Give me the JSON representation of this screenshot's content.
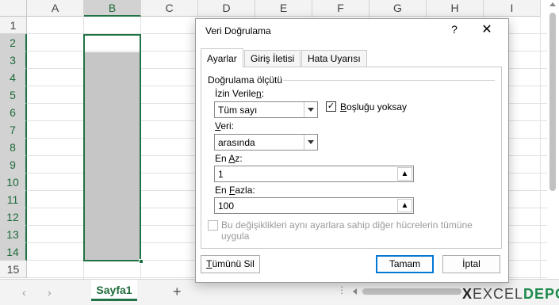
{
  "spreadsheet": {
    "columns": [
      "A",
      "B",
      "C",
      "D",
      "E",
      "F",
      "G",
      "H",
      "I"
    ],
    "rows": [
      "1",
      "2",
      "3",
      "4",
      "5",
      "6",
      "7",
      "8",
      "9",
      "10",
      "11",
      "12",
      "13",
      "14",
      "15"
    ],
    "selected_column": "B",
    "selected_range": "B2:B14"
  },
  "sheet_tabs": {
    "prev_icon": "chevron-left-icon",
    "next_icon": "chevron-right-icon",
    "active_sheet": "Sayfa1",
    "add_sheet_label": "+",
    "options_label": "⋮"
  },
  "logo": {
    "x": "X",
    "excel": "EXCEL",
    "depo": "DEPO"
  },
  "dialog": {
    "title": "Veri Doğrulama",
    "help_label": "?",
    "close_label": "✕",
    "tabs": [
      {
        "label": "Ayarlar",
        "active": true
      },
      {
        "label": "Giriş İletisi",
        "active": false
      },
      {
        "label": "Hata Uyarısı",
        "active": false
      }
    ],
    "group_label": "Doğrulama ölçütü",
    "allow": {
      "label_before": "İzin Verile",
      "label_underline": "n",
      "label_after": ":",
      "value": "Tüm sayı"
    },
    "ignore_blank": {
      "label_underline": "B",
      "label_rest": "oşluğu yoksay",
      "checked": true
    },
    "data": {
      "label_underline": "V",
      "label_rest": "eri:",
      "value": "arasında"
    },
    "minimum": {
      "label_before": "En ",
      "label_underline": "A",
      "label_after": "z:",
      "value": "1"
    },
    "maximum": {
      "label_before": "En ",
      "label_underline": "F",
      "label_after": "azla:",
      "value": "100"
    },
    "apply_all": {
      "label_line1": "Bu değişiklikleri aynı ayarlara sahip diğer hücrelerin tümüne",
      "label_line2": "uygula",
      "checked": false,
      "disabled": true
    },
    "buttons": {
      "clear_all_underline": "T",
      "clear_all_rest": "ümünü Sil",
      "ok": "Tamam",
      "cancel": "İptal"
    }
  }
}
